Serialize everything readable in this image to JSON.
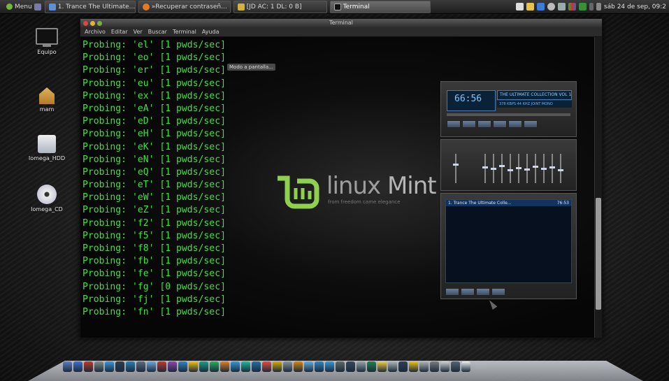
{
  "top_panel": {
    "menu_label": "Menu",
    "tasks": [
      {
        "label": "1. Trance The Ultimate...",
        "icon": "music-icon",
        "color": "#5b8fd6"
      },
      {
        "label": "»Recuperar contraseñ...",
        "icon": "firefox-icon",
        "color": "#e07b22"
      },
      {
        "label": "[JD AC: 1 DL: 0 B]",
        "icon": "jdownloader-icon",
        "color": "#d4b13c"
      },
      {
        "label": "Terminal",
        "icon": "terminal-icon",
        "color": "#222222"
      }
    ],
    "clock": "sáb 24 de sep, 09:2"
  },
  "desktop_icons": [
    {
      "label": "Equipo",
      "icon": "computer-icon"
    },
    {
      "label": "mam",
      "icon": "home-folder-icon"
    },
    {
      "label": "Iomega_HDD",
      "icon": "drive-icon"
    },
    {
      "label": "Iomega_CD",
      "icon": "cd-icon"
    }
  ],
  "terminal": {
    "title": "Terminal",
    "menu": [
      "Archivo",
      "Editar",
      "Ver",
      "Buscar",
      "Terminal",
      "Ayuda"
    ],
    "lines": [
      "Probing: 'el' [1 pwds/sec]",
      "Probing: 'eo' [1 pwds/sec]",
      "Probing: 'er' [1 pwds/sec]",
      "Probing: 'eu' [1 pwds/sec]",
      "Probing: 'ex' [1 pwds/sec]",
      "Probing: 'eA' [1 pwds/sec]",
      "Probing: 'eD' [1 pwds/sec]",
      "Probing: 'eH' [1 pwds/sec]",
      "Probing: 'eK' [1 pwds/sec]",
      "Probing: 'eN' [1 pwds/sec]",
      "Probing: 'eQ' [1 pwds/sec]",
      "Probing: 'eT' [1 pwds/sec]",
      "Probing: 'eW' [1 pwds/sec]",
      "Probing: 'eZ' [1 pwds/sec]",
      "Probing: 'f2' [1 pwds/sec]",
      "Probing: 'f5' [1 pwds/sec]",
      "Probing: 'f8' [1 pwds/sec]",
      "Probing: 'fb' [1 pwds/sec]",
      "Probing: 'fe' [1 pwds/sec]",
      "Probing: 'fg' [0 pwds/sec]",
      "Probing: 'fj' [1 pwds/sec]",
      "Probing: 'fn' [1 pwds/sec]"
    ],
    "text_color": "#39e636"
  },
  "tooltip": "Modo a pantalla...",
  "wallpaper": {
    "brand_linux": "linux",
    "brand_mint": "Mint",
    "tagline": "from freedom came elegance"
  },
  "winamp": {
    "time": "66:56",
    "track_scroll": "THE ULTIMATE COLLECTION VOL 1",
    "info": "378 KBPS  44 KHZ  JOINT MONO",
    "playlist_item": "1. Trance The Ultimate Colle...",
    "playlist_time": "76:53",
    "accent": "#4a77b0"
  },
  "dock": {
    "colors": [
      "#5a7fc4",
      "#3d6fd1",
      "#c0392b",
      "#7f8c8d",
      "#3498db",
      "#2c3e50",
      "#2980b9",
      "#5d6d7e",
      "#6fa8dc",
      "#c0392b",
      "#8e44ad",
      "#2e86c1",
      "#f1c40f",
      "#16a085",
      "#27ae60",
      "#e67e22",
      "#3498db",
      "#1abc9c",
      "#2471a3",
      "#e74c3c",
      "#d4ac0d",
      "#85929e",
      "#d68910",
      "#5dade2",
      "#2e86c1",
      "#3498db",
      "#5f6a6a",
      "#34495e",
      "#95a5a6",
      "#1e8449",
      "#f4d03f",
      "#aab7b8",
      "#2e4053",
      "#f1c40f",
      "#b3b6b7",
      "#7b7d7d",
      "#d0d3d4",
      "#566573",
      "#ecf0f1"
    ]
  }
}
